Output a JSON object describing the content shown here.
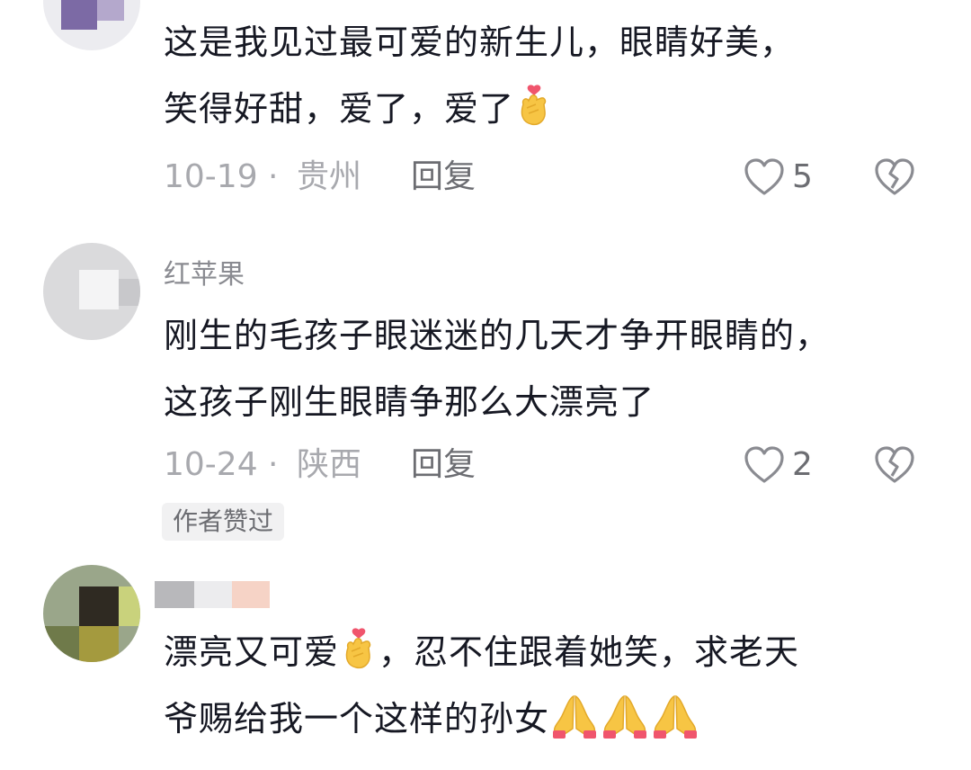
{
  "comments": [
    {
      "username": "",
      "text_line1": "这是我见过最可爱的新生儿，眼睛好美，",
      "text_line2": "笑得好甜，爱了，爱了",
      "date": "10-19",
      "region": "贵州",
      "reply": "回复",
      "likes": "5"
    },
    {
      "username": "红苹果",
      "text_line1": "刚生的毛孩子眼迷迷的几天才争开眼睛的，",
      "text_line2": "这孩子刚生眼睛争那么大漂亮了",
      "date": "10-24",
      "region": "陕西",
      "reply": "回复",
      "likes": "2",
      "badge": "作者赞过"
    },
    {
      "username": "",
      "text_line1": "漂亮又可爱",
      "text_line1b": "，忍不住跟着她笑，求老天",
      "text_line2": "爷赐给我一个这样的孙女"
    }
  ],
  "separator": "·",
  "icons": {
    "like": "heart-outline-icon",
    "dislike": "broken-heart-icon",
    "finger_heart": "finger-heart-emoji",
    "pray": "folded-hands-emoji"
  },
  "colors": {
    "text": "#161823",
    "meta": "#a8a9ae",
    "badge_bg": "#f1f1f2",
    "emoji_yellow": "#f7c544"
  }
}
